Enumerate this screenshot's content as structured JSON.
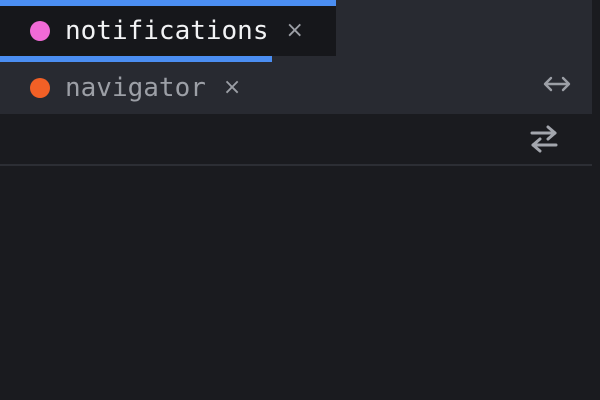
{
  "tabs": [
    {
      "label": "notifications",
      "dot_color": "#f06ad6",
      "active": true
    },
    {
      "label": "navigator",
      "dot_color": "#f26026",
      "active": false
    }
  ],
  "tab_close_glyph": "×",
  "icons": {
    "expand": "expand-horizontal-icon",
    "swap": "swap-arrows-icon"
  },
  "colors": {
    "accent": "#4b8ef2",
    "tabstrip_bg": "#282a31",
    "active_tab_bg": "#16171b",
    "panel_bg": "#1a1b1f"
  }
}
